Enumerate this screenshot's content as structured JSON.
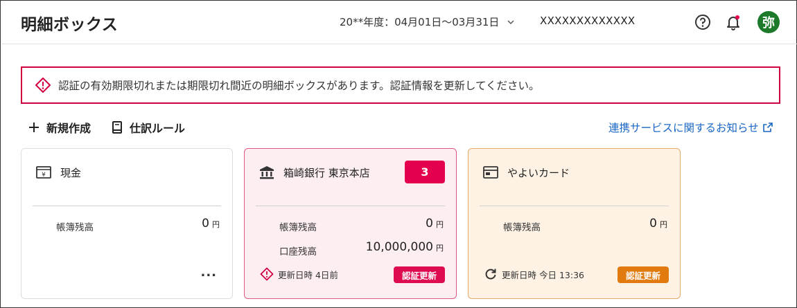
{
  "header": {
    "app_title": "明細ボックス",
    "period": "20**年度：04月01日〜03月31日",
    "account": "XXXXXXXXXXXXX",
    "avatar_initial": "弥"
  },
  "alert": {
    "message": "認証の有効期限切れまたは期限切れ間近の明細ボックスがあります。認証情報を更新してください。",
    "color": "#d3003f"
  },
  "toolbar": {
    "new_label": "新規作成",
    "rule_label": "仕訳ルール",
    "notice_link": "連携サービスに関するお知らせ"
  },
  "cards": [
    {
      "name": "現金",
      "icon": "cash-register-icon",
      "book_balance_label": "帳簿残高",
      "book_balance": "0",
      "unit": "円",
      "more": "..."
    },
    {
      "name": "箱崎銀行 東京本店",
      "icon": "bank-icon",
      "badge_count": "3",
      "book_balance_label": "帳簿残高",
      "book_balance": "0",
      "account_balance_label": "口座残高",
      "account_balance": "10,000,000",
      "unit": "円",
      "update_text": "更新日時 4日前",
      "auth_button": "認証更新",
      "accent": "#df0b50"
    },
    {
      "name": "やよいカード",
      "icon": "credit-card-icon",
      "book_balance_label": "帳簿残高",
      "book_balance": "0",
      "unit": "円",
      "update_text": "更新日時 今日 13:36",
      "auth_button": "認証更新",
      "accent": "#e17b10"
    }
  ]
}
